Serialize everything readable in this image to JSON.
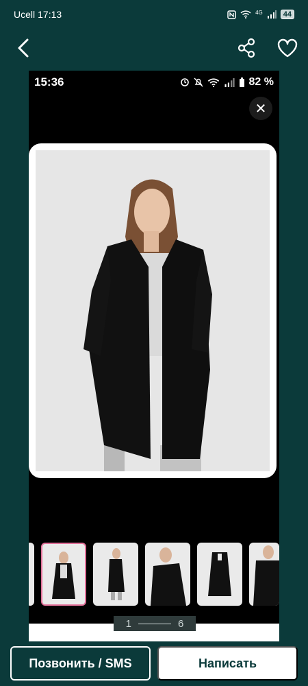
{
  "status_bar": {
    "carrier": "Ucell",
    "time": "17:13",
    "network": "4G",
    "battery": "44"
  },
  "inner_status": {
    "time": "15:36",
    "battery_pct": "82 %"
  },
  "viewer": {
    "close_symbol": "✕",
    "page_current": "1",
    "page_total": "6"
  },
  "actions": {
    "call_label": "Позвонить / SMS",
    "write_label": "Написать"
  },
  "icons": [
    "back-icon",
    "share-icon",
    "heart-icon",
    "close-icon",
    "nfc-icon",
    "wifi-icon",
    "signal-icon",
    "battery-icon"
  ],
  "colors": {
    "background": "#0b3a3a",
    "thumb_active": "#e2719a",
    "coat": "#111111"
  }
}
